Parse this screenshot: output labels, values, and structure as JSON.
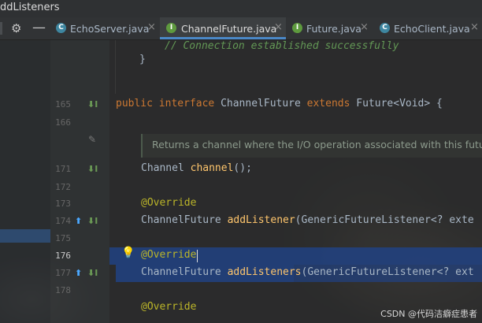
{
  "window": {
    "title_fragment": "ddListeners"
  },
  "toolbar": {
    "gear_icon": "gear-icon",
    "minimize_icon": "minus-icon"
  },
  "tabs": [
    {
      "label": "EchoServer.java",
      "icon": "C",
      "icon_kind": "class",
      "active": false
    },
    {
      "label": "ChannelFuture.java",
      "icon": "I",
      "icon_kind": "interface",
      "active": true
    },
    {
      "label": "Future.java",
      "icon": "I",
      "icon_kind": "interface",
      "active": false
    },
    {
      "label": "EchoClient.java",
      "icon": "C",
      "icon_kind": "class",
      "active": false
    }
  ],
  "tab_close": "×",
  "editor": {
    "top_comment": "// Connection established successfully",
    "top_brace": "}",
    "line_numbers": [
      "165",
      "166",
      "171",
      "172",
      "173",
      "174",
      "175",
      "176",
      "177",
      "178"
    ],
    "line_165": {
      "kw1": "public",
      "kw2": "interface",
      "name": "ChannelFuture",
      "kw3": "extends",
      "rest": "Future<Void> {"
    },
    "doc_comment": "Returns a channel where the I/O operation associated with this future",
    "line_171": {
      "type": "Channel",
      "method": "channel",
      "rest": "();"
    },
    "line_173": "@Override",
    "line_174": {
      "type": "ChannelFuture",
      "method": "addListener",
      "rest": "(GenericFutureListener<? exte"
    },
    "line_176": "@Override",
    "line_177": {
      "type": "ChannelFuture",
      "method": "addListeners",
      "rest": "(GenericFutureListener<? ext"
    },
    "line_179": "@Override"
  },
  "watermark": "CSDN @代码洁癖症患者"
}
